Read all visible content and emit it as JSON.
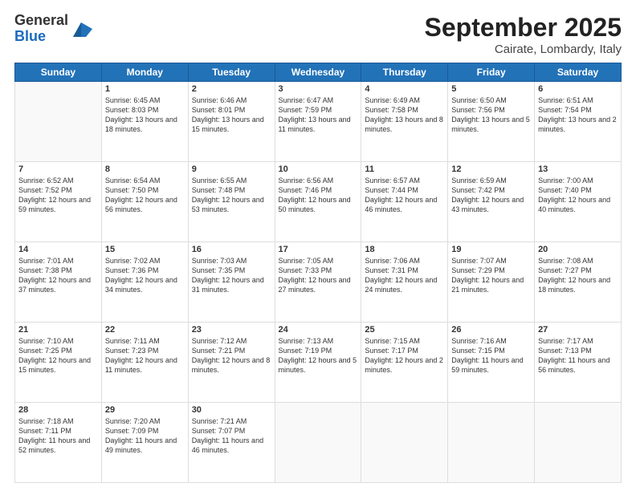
{
  "logo": {
    "general": "General",
    "blue": "Blue"
  },
  "title": "September 2025",
  "location": "Cairate, Lombardy, Italy",
  "days_of_week": [
    "Sunday",
    "Monday",
    "Tuesday",
    "Wednesday",
    "Thursday",
    "Friday",
    "Saturday"
  ],
  "weeks": [
    [
      {
        "day": null,
        "info": null
      },
      {
        "day": "1",
        "sunrise": "6:45 AM",
        "sunset": "8:03 PM",
        "daylight": "13 hours and 18 minutes."
      },
      {
        "day": "2",
        "sunrise": "6:46 AM",
        "sunset": "8:01 PM",
        "daylight": "13 hours and 15 minutes."
      },
      {
        "day": "3",
        "sunrise": "6:47 AM",
        "sunset": "7:59 PM",
        "daylight": "13 hours and 11 minutes."
      },
      {
        "day": "4",
        "sunrise": "6:49 AM",
        "sunset": "7:58 PM",
        "daylight": "13 hours and 8 minutes."
      },
      {
        "day": "5",
        "sunrise": "6:50 AM",
        "sunset": "7:56 PM",
        "daylight": "13 hours and 5 minutes."
      },
      {
        "day": "6",
        "sunrise": "6:51 AM",
        "sunset": "7:54 PM",
        "daylight": "13 hours and 2 minutes."
      }
    ],
    [
      {
        "day": "7",
        "sunrise": "6:52 AM",
        "sunset": "7:52 PM",
        "daylight": "12 hours and 59 minutes."
      },
      {
        "day": "8",
        "sunrise": "6:54 AM",
        "sunset": "7:50 PM",
        "daylight": "12 hours and 56 minutes."
      },
      {
        "day": "9",
        "sunrise": "6:55 AM",
        "sunset": "7:48 PM",
        "daylight": "12 hours and 53 minutes."
      },
      {
        "day": "10",
        "sunrise": "6:56 AM",
        "sunset": "7:46 PM",
        "daylight": "12 hours and 50 minutes."
      },
      {
        "day": "11",
        "sunrise": "6:57 AM",
        "sunset": "7:44 PM",
        "daylight": "12 hours and 46 minutes."
      },
      {
        "day": "12",
        "sunrise": "6:59 AM",
        "sunset": "7:42 PM",
        "daylight": "12 hours and 43 minutes."
      },
      {
        "day": "13",
        "sunrise": "7:00 AM",
        "sunset": "7:40 PM",
        "daylight": "12 hours and 40 minutes."
      }
    ],
    [
      {
        "day": "14",
        "sunrise": "7:01 AM",
        "sunset": "7:38 PM",
        "daylight": "12 hours and 37 minutes."
      },
      {
        "day": "15",
        "sunrise": "7:02 AM",
        "sunset": "7:36 PM",
        "daylight": "12 hours and 34 minutes."
      },
      {
        "day": "16",
        "sunrise": "7:03 AM",
        "sunset": "7:35 PM",
        "daylight": "12 hours and 31 minutes."
      },
      {
        "day": "17",
        "sunrise": "7:05 AM",
        "sunset": "7:33 PM",
        "daylight": "12 hours and 27 minutes."
      },
      {
        "day": "18",
        "sunrise": "7:06 AM",
        "sunset": "7:31 PM",
        "daylight": "12 hours and 24 minutes."
      },
      {
        "day": "19",
        "sunrise": "7:07 AM",
        "sunset": "7:29 PM",
        "daylight": "12 hours and 21 minutes."
      },
      {
        "day": "20",
        "sunrise": "7:08 AM",
        "sunset": "7:27 PM",
        "daylight": "12 hours and 18 minutes."
      }
    ],
    [
      {
        "day": "21",
        "sunrise": "7:10 AM",
        "sunset": "7:25 PM",
        "daylight": "12 hours and 15 minutes."
      },
      {
        "day": "22",
        "sunrise": "7:11 AM",
        "sunset": "7:23 PM",
        "daylight": "12 hours and 11 minutes."
      },
      {
        "day": "23",
        "sunrise": "7:12 AM",
        "sunset": "7:21 PM",
        "daylight": "12 hours and 8 minutes."
      },
      {
        "day": "24",
        "sunrise": "7:13 AM",
        "sunset": "7:19 PM",
        "daylight": "12 hours and 5 minutes."
      },
      {
        "day": "25",
        "sunrise": "7:15 AM",
        "sunset": "7:17 PM",
        "daylight": "12 hours and 2 minutes."
      },
      {
        "day": "26",
        "sunrise": "7:16 AM",
        "sunset": "7:15 PM",
        "daylight": "11 hours and 59 minutes."
      },
      {
        "day": "27",
        "sunrise": "7:17 AM",
        "sunset": "7:13 PM",
        "daylight": "11 hours and 56 minutes."
      }
    ],
    [
      {
        "day": "28",
        "sunrise": "7:18 AM",
        "sunset": "7:11 PM",
        "daylight": "11 hours and 52 minutes."
      },
      {
        "day": "29",
        "sunrise": "7:20 AM",
        "sunset": "7:09 PM",
        "daylight": "11 hours and 49 minutes."
      },
      {
        "day": "30",
        "sunrise": "7:21 AM",
        "sunset": "7:07 PM",
        "daylight": "11 hours and 46 minutes."
      },
      {
        "day": null,
        "info": null
      },
      {
        "day": null,
        "info": null
      },
      {
        "day": null,
        "info": null
      },
      {
        "day": null,
        "info": null
      }
    ]
  ]
}
